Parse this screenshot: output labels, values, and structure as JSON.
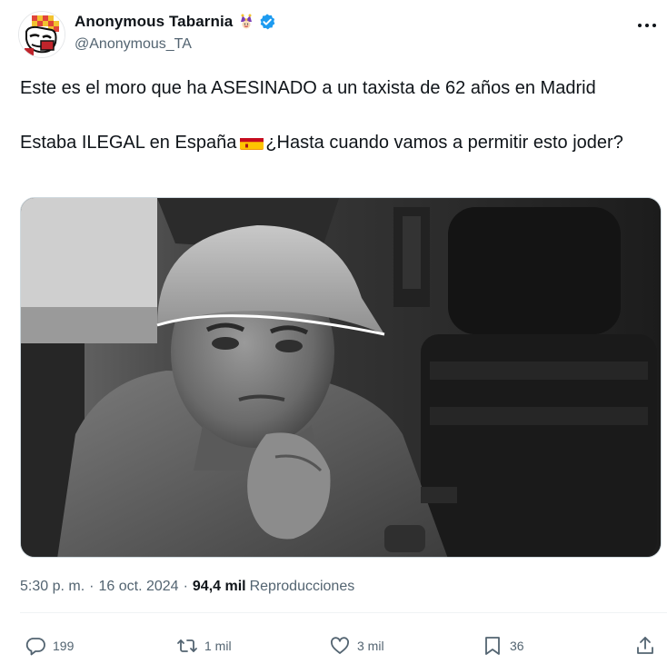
{
  "author": {
    "display_name": "Anonymous Tabarnia",
    "handle": "@Anonymous_TA",
    "name_emoji": "jester-emoji-icon",
    "verified_badge": "verified-badge-icon",
    "verified_color": "#1d9bf0"
  },
  "tweet": {
    "line1": "Este es el moro que ha ASESINADO a un taxista de 62 años en Madrid",
    "line2_before_flag": "Estaba ILEGAL en España",
    "flag": "spain-flag-icon",
    "line2_after_flag": "¿Hasta cuando vamos a permitir esto joder?"
  },
  "media": {
    "type": "photo",
    "style": "grayscale"
  },
  "meta": {
    "time": "5:30 p. m.",
    "separator": "·",
    "date": "16 oct. 2024",
    "views_count": "94,4 mil",
    "views_label": "Reproducciones"
  },
  "actions": {
    "reply_count": "199",
    "repost_count": "1 mil",
    "like_count": "3 mil",
    "bookmark_count": "36"
  },
  "colors": {
    "text_primary": "#0f1419",
    "text_secondary": "#536471",
    "border": "#cfd9de"
  }
}
